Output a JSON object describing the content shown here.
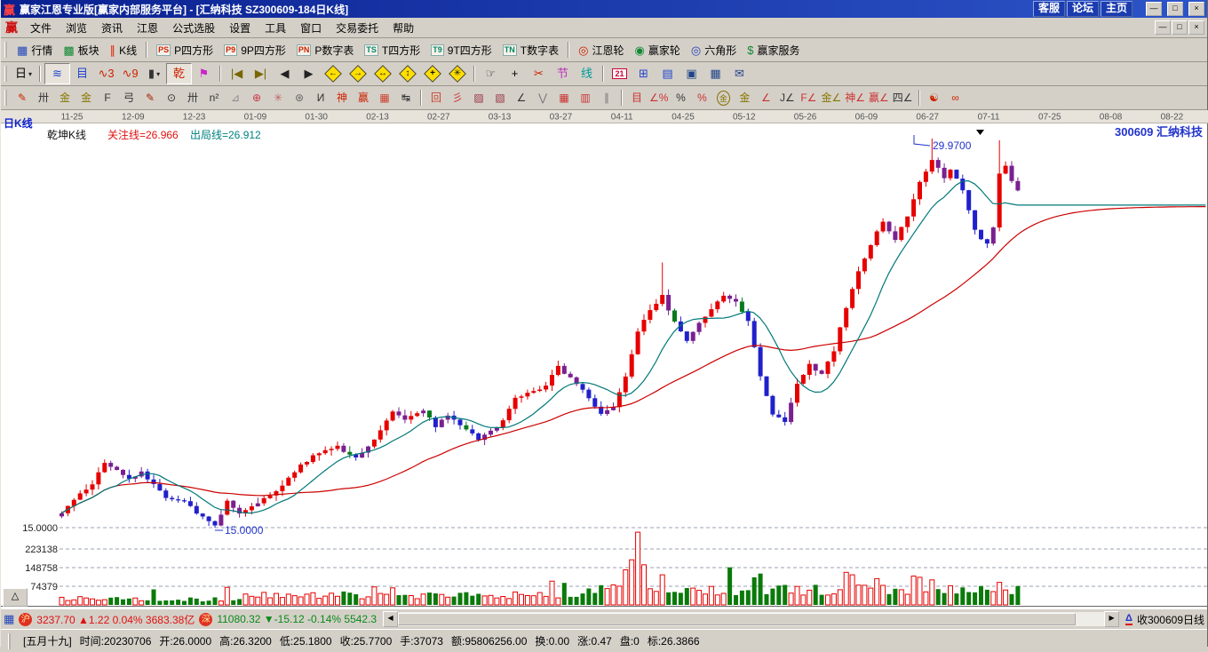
{
  "window": {
    "logo": "赢",
    "title": "赢家江恩专业版[赢家内部服务平台] - [汇纳科技  SZ300609-184日K线]",
    "link_buttons": [
      "客服",
      "论坛",
      "主页"
    ],
    "controls": [
      "—",
      "□",
      "×"
    ]
  },
  "menu": {
    "logo": "赢",
    "items": [
      "文件",
      "浏览",
      "资讯",
      "江恩",
      "公式选股",
      "设置",
      "工具",
      "窗口",
      "交易委托",
      "帮助"
    ]
  },
  "toolbar_main": {
    "items": [
      {
        "name": "quotes",
        "label": "行情",
        "icon": "quote-grid-icon",
        "glyph": "▦",
        "color": "#2244bb"
      },
      {
        "name": "sectors",
        "label": "板块",
        "icon": "sector-blocks-icon",
        "glyph": "▩",
        "color": "#118833"
      },
      {
        "name": "kline",
        "label": "K线",
        "icon": "candles-icon",
        "glyph": "∥",
        "color": "#dd2200"
      },
      {
        "sep": true
      },
      {
        "name": "p-square",
        "label": "P四方形",
        "icon": "ps-badge-icon",
        "badge": "PS",
        "color": "#cc2200"
      },
      {
        "name": "p9-square",
        "label": "9P四方形",
        "icon": "p9-badge-icon",
        "badge": "P9",
        "color": "#cc2200"
      },
      {
        "name": "p-number",
        "label": "P数字表",
        "icon": "pn-badge-icon",
        "badge": "PN",
        "color": "#cc2200"
      },
      {
        "name": "t-square",
        "label": "T四方形",
        "icon": "ts-badge-icon",
        "badge": "TS",
        "color": "#008866"
      },
      {
        "name": "t9-square",
        "label": "9T四方形",
        "icon": "t9-badge-icon",
        "badge": "T9",
        "color": "#008866"
      },
      {
        "name": "t-number",
        "label": "T数字表",
        "icon": "tn-badge-icon",
        "badge": "TN",
        "color": "#008866"
      },
      {
        "sep": true
      },
      {
        "name": "gann-wheel",
        "label": "江恩轮",
        "icon": "gann-wheel-icon",
        "glyph": "◎",
        "color": "#cc2200"
      },
      {
        "name": "winner-wheel",
        "label": "赢家轮",
        "icon": "winner-wheel-icon",
        "glyph": "◉",
        "color": "#118833"
      },
      {
        "name": "hexagon",
        "label": "六角形",
        "icon": "hexagon-icon",
        "glyph": "◎",
        "color": "#2244bb"
      },
      {
        "name": "winner-service",
        "label": "赢家服务",
        "icon": "service-icon",
        "glyph": "$",
        "color": "#118833"
      }
    ]
  },
  "toolbar_nav": {
    "items": [
      {
        "name": "period-daily",
        "glyph": "日",
        "color": "#000000",
        "dropdown": true
      },
      {
        "sep": true
      },
      {
        "name": "zoom-area",
        "glyph": "≋",
        "color": "#2244cc",
        "pressed": true
      },
      {
        "name": "f10-info",
        "glyph": "目",
        "color": "#2244cc"
      },
      {
        "name": "wave-3",
        "glyph": "∿3",
        "color": "#cc2200"
      },
      {
        "name": "wave-9",
        "glyph": "∿9",
        "color": "#cc2200"
      },
      {
        "name": "candle-style",
        "glyph": "▮",
        "color": "#333333",
        "dropdown": true
      },
      {
        "name": "qiankun-kline",
        "glyph": "乾",
        "color": "#cc2200",
        "pressed": true
      },
      {
        "name": "signal-flag",
        "glyph": "⚑",
        "color": "#cc22cc"
      },
      {
        "sep": true
      },
      {
        "name": "first-page",
        "glyph": "|◀",
        "color": "#776600"
      },
      {
        "name": "last-page",
        "glyph": "▶|",
        "color": "#776600"
      },
      {
        "name": "prev-bar",
        "glyph": "◀",
        "color": "#222222"
      },
      {
        "name": "next-bar",
        "glyph": "▶",
        "color": "#222222"
      },
      {
        "name": "pan-left",
        "kind": "diamond",
        "glyph": "←"
      },
      {
        "name": "pan-right",
        "kind": "diamond",
        "glyph": "→"
      },
      {
        "name": "h-scale",
        "kind": "diamond",
        "glyph": "↔"
      },
      {
        "name": "v-scale",
        "kind": "diamond",
        "glyph": "↕"
      },
      {
        "name": "zoom-in",
        "kind": "diamond",
        "glyph": "+"
      },
      {
        "name": "zoom-fit",
        "kind": "diamond",
        "glyph": "✳"
      },
      {
        "sep": true
      },
      {
        "name": "hand-drag",
        "glyph": "☞",
        "color": "#333333"
      },
      {
        "name": "crosshair",
        "glyph": "+",
        "color": "#000000"
      },
      {
        "name": "cut-tool",
        "glyph": "✂",
        "color": "#cc2200"
      },
      {
        "name": "festival-marker",
        "glyph": "节",
        "color": "#bb33bb"
      },
      {
        "name": "curve-tool",
        "glyph": "线",
        "color": "#009999"
      },
      {
        "sep": true
      },
      {
        "name": "calendar",
        "glyph": "21",
        "kind": "boxed"
      },
      {
        "name": "calculator",
        "glyph": "⊞",
        "color": "#2244cc"
      },
      {
        "name": "notes",
        "glyph": "▤",
        "color": "#2244cc"
      },
      {
        "name": "save",
        "glyph": "▣",
        "color": "#224488"
      },
      {
        "name": "capture",
        "glyph": "▦",
        "color": "#224488"
      },
      {
        "name": "mail",
        "glyph": "✉",
        "color": "#224488"
      }
    ]
  },
  "toolbar_draw": {
    "items": [
      {
        "name": "pen",
        "glyph": "✎",
        "color": "#cc2200"
      },
      {
        "name": "gann-grid",
        "glyph": "卅",
        "color": "#333333"
      },
      {
        "name": "gold-section",
        "glyph": "金",
        "color": "#887700"
      },
      {
        "name": "gold-section-2",
        "glyph": "金",
        "color": "#887700"
      },
      {
        "name": "fibo-f",
        "glyph": "F",
        "color": "#333333"
      },
      {
        "name": "spiral",
        "glyph": "弓",
        "color": "#333333"
      },
      {
        "name": "ruler-pen",
        "glyph": "✎",
        "color": "#aa2200"
      },
      {
        "name": "time-circle",
        "glyph": "⊙",
        "color": "#333333"
      },
      {
        "name": "time-grid",
        "glyph": "卅",
        "color": "#333333"
      },
      {
        "name": "n-square",
        "glyph": "n²",
        "color": "#333333"
      },
      {
        "name": "angle-guide",
        "glyph": "⊿",
        "color": "#888888"
      },
      {
        "name": "target-circle",
        "glyph": "⊕",
        "color": "#cc3344"
      },
      {
        "name": "starburst",
        "glyph": "✳",
        "color": "#bb6666"
      },
      {
        "name": "spider-web",
        "glyph": "⊛",
        "color": "#666666"
      },
      {
        "name": "wave-marker",
        "glyph": "И",
        "color": "#333333"
      },
      {
        "name": "shen-tool",
        "glyph": "神",
        "color": "#cc2200"
      },
      {
        "name": "ying-tool",
        "glyph": "赢",
        "color": "#cc2200"
      },
      {
        "name": "number-grid",
        "glyph": "▦",
        "color": "#cc4433"
      },
      {
        "name": "span-measure",
        "glyph": "↹",
        "color": "#333333"
      },
      {
        "sep": true
      },
      {
        "name": "rect-handles",
        "glyph": "回",
        "color": "#cc4433"
      },
      {
        "name": "ray-fan",
        "glyph": "彡",
        "color": "#cc3333"
      },
      {
        "name": "fan-box",
        "glyph": "▨",
        "color": "#993344"
      },
      {
        "name": "fan-box-2",
        "glyph": "▧",
        "color": "#993344"
      },
      {
        "name": "trend-angle",
        "glyph": "∠",
        "color": "#333333"
      },
      {
        "name": "zigzag",
        "glyph": "⋁",
        "color": "#777777"
      },
      {
        "name": "grid-red",
        "glyph": "▦",
        "color": "#cc3333"
      },
      {
        "name": "grid-red-2",
        "glyph": "▥",
        "color": "#cc3333"
      },
      {
        "name": "parallel-lines",
        "glyph": "∥",
        "color": "#777777"
      },
      {
        "sep": true
      },
      {
        "name": "price-ladder",
        "glyph": "目",
        "color": "#cc3333"
      },
      {
        "name": "pct-angle",
        "glyph": "∠%",
        "color": "#cc3333"
      },
      {
        "name": "percent",
        "glyph": "%",
        "color": "#333333"
      },
      {
        "name": "pct-bar",
        "glyph": "%",
        "color": "#cc3333"
      },
      {
        "name": "gold-circle",
        "glyph": "金",
        "kind": "round",
        "color": "#887700"
      },
      {
        "name": "gold-bar",
        "glyph": "金",
        "color": "#887700"
      },
      {
        "name": "ink-angle",
        "glyph": "∠",
        "color": "#cc3333"
      },
      {
        "name": "j-angle",
        "glyph": "J∠",
        "color": "#333333"
      },
      {
        "name": "f-angle",
        "glyph": "F∠",
        "color": "#cc3333"
      },
      {
        "name": "gold-angle",
        "glyph": "金∠",
        "color": "#887700"
      },
      {
        "name": "shen-angle",
        "glyph": "神∠",
        "color": "#cc3333"
      },
      {
        "name": "ying-angle",
        "glyph": "赢∠",
        "color": "#cc3333"
      },
      {
        "name": "sifang-angle",
        "glyph": "四∠",
        "color": "#333333"
      },
      {
        "sep": true
      },
      {
        "name": "taiji",
        "glyph": "☯",
        "color": "#cc2200"
      },
      {
        "name": "infinity",
        "glyph": "∞",
        "color": "#cc2200"
      }
    ]
  },
  "chart": {
    "pane_label": "日K线",
    "model_label": "乾坤K线",
    "attention_label": "关注线=26.966",
    "exit_label": "出局线=26.912",
    "stock_label": "300609  汇纳科技",
    "peak_label": "29.9700",
    "low_label": "15.0000",
    "price_axis_left": "15.0000",
    "expand_button": "△"
  },
  "chart_data": {
    "type": "candlestick",
    "symbol": "SZ300609",
    "name": "汇纳科技",
    "period": "日K线",
    "title_bars": "184日K线",
    "visible_bars": 157,
    "dates": [
      "11-25",
      "12-09",
      "12-23",
      "01-09",
      "01-30",
      "02-13",
      "02-27",
      "03-13",
      "03-27",
      "04-11",
      "04-25",
      "05-12",
      "05-26",
      "06-09",
      "06-27",
      "07-11",
      "07-25",
      "08-08",
      "08-22"
    ],
    "price_low": 15.0,
    "price_peak": 29.97,
    "attention_value": 26.966,
    "exit_value": 26.912,
    "volume_gridlines": [
      223138,
      148758,
      74379
    ],
    "price_anchors": [
      [
        0,
        15.6
      ],
      [
        5,
        16.7
      ],
      [
        7,
        17.5
      ],
      [
        9,
        17.2
      ],
      [
        11,
        16.9
      ],
      [
        13,
        17.1
      ],
      [
        17,
        16.2
      ],
      [
        20,
        16.0
      ],
      [
        22,
        15.6
      ],
      [
        25,
        15.05
      ],
      [
        27,
        16.0
      ],
      [
        29,
        15.5
      ],
      [
        31,
        15.85
      ],
      [
        35,
        16.4
      ],
      [
        39,
        17.4
      ],
      [
        42,
        17.9
      ],
      [
        45,
        18.1
      ],
      [
        48,
        17.7
      ],
      [
        51,
        18.4
      ],
      [
        54,
        19.5
      ],
      [
        56,
        19.2
      ],
      [
        59,
        19.5
      ],
      [
        61,
        18.9
      ],
      [
        63,
        19.3
      ],
      [
        66,
        18.8
      ],
      [
        68,
        18.4
      ],
      [
        70,
        18.7
      ],
      [
        72,
        19.1
      ],
      [
        74,
        20.0
      ],
      [
        77,
        20.2
      ],
      [
        79,
        20.5
      ],
      [
        81,
        21.2
      ],
      [
        84,
        20.5
      ],
      [
        86,
        20.0
      ],
      [
        88,
        19.4
      ],
      [
        90,
        19.6
      ],
      [
        92,
        20.8
      ],
      [
        94,
        22.5
      ],
      [
        96,
        23.4
      ],
      [
        98,
        23.9
      ],
      [
        100,
        22.9
      ],
      [
        102,
        22.2
      ],
      [
        104,
        22.9
      ],
      [
        106,
        23.4
      ],
      [
        108,
        23.9
      ],
      [
        110,
        23.7
      ],
      [
        112,
        23.0
      ],
      [
        114,
        20.8
      ],
      [
        116,
        19.4
      ],
      [
        118,
        19.1
      ],
      [
        120,
        20.5
      ],
      [
        122,
        21.3
      ],
      [
        124,
        20.9
      ],
      [
        126,
        21.8
      ],
      [
        128,
        23.5
      ],
      [
        130,
        24.9
      ],
      [
        132,
        25.9
      ],
      [
        134,
        26.8
      ],
      [
        136,
        26.1
      ],
      [
        138,
        27.0
      ],
      [
        140,
        28.3
      ],
      [
        142,
        29.2
      ],
      [
        144,
        28.5
      ],
      [
        145,
        28.8
      ],
      [
        147,
        28.0
      ],
      [
        149,
        26.4
      ],
      [
        151,
        25.9
      ],
      [
        152,
        26.5
      ],
      [
        153,
        28.6
      ],
      [
        154,
        28.9
      ],
      [
        155,
        28.3
      ],
      [
        156,
        28.0
      ]
    ],
    "wick_overrides": {
      "25": {
        "low": 15.0
      },
      "98": {
        "high": 25.2
      },
      "142": {
        "high": 29.97
      },
      "153": {
        "high": 29.9
      }
    },
    "volume_overrides": {
      "15": 62000,
      "27": 70000,
      "51": 72000,
      "54": 68000,
      "80": 95000,
      "82": 88000,
      "92": 140000,
      "93": 180000,
      "94": 290000,
      "95": 160000,
      "98": 120000,
      "109": 150000,
      "113": 110000,
      "114": 125000,
      "128": 130000,
      "129": 120000,
      "133": 105000,
      "139": 115000,
      "140": 110000,
      "142": 100000,
      "153": 90000
    },
    "colors": {
      "up": "#e60000",
      "down": "#2020cc",
      "neutral_up": "#7a2090",
      "neutral_down": "#0a7a20",
      "ma_short": "#007878",
      "ma_long": "#cc0000",
      "vol_up": "#e60000",
      "vol_down": "#0a7a0a",
      "grid": "#99a0b0",
      "annotation": "#2233cc"
    }
  },
  "status_market": {
    "sh_icon": "沪",
    "sh_text": "3237.70 ▲1.22 0.04% 3683.38亿",
    "sz_icon": "深",
    "sz_text": "11080.32 ▼-15.12 -0.14% 5542.3",
    "right_label": "收300609日线"
  },
  "status_detail": {
    "fields": [
      "[五月十九]",
      "时间:20230706",
      "开:26.0000",
      "高:26.3200",
      "低:25.1800",
      "收:25.7700",
      "手:37073",
      "额:95806256.00",
      "换:0.00",
      "涨:0.47",
      "盘:0",
      "标:26.3866"
    ]
  }
}
